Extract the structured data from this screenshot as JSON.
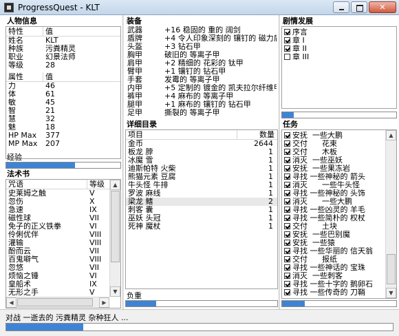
{
  "window": {
    "title": "ProgressQuest - KLT"
  },
  "character": {
    "header": "人物信息",
    "col_trait": "特性",
    "col_value": "值",
    "traits": [
      {
        "name": "姓名",
        "value": "KLT"
      },
      {
        "name": "种族",
        "value": "污粪精灵"
      },
      {
        "name": "职业",
        "value": "幻景法师"
      },
      {
        "name": "等级",
        "value": "28"
      }
    ],
    "col_stat": "属性",
    "col_stat_value": "值",
    "stats": [
      {
        "name": "力",
        "value": "46"
      },
      {
        "name": "体",
        "value": "61"
      },
      {
        "name": "敏",
        "value": "45"
      },
      {
        "name": "智",
        "value": "21"
      },
      {
        "name": "慧",
        "value": "32"
      },
      {
        "name": "魅",
        "value": "18"
      },
      {
        "name": "HP Max",
        "value": "377"
      },
      {
        "name": "MP Max",
        "value": "207"
      }
    ],
    "exp_label": "经验",
    "exp_progress": 0.6
  },
  "spellbook": {
    "header": "法术书",
    "col_spell": "咒语",
    "col_level": "等级",
    "spells": [
      {
        "name": "史莱姆之触",
        "level": "V"
      },
      {
        "name": "忽伤",
        "level": "X"
      },
      {
        "name": "急速",
        "level": "IX"
      },
      {
        "name": "磁性球",
        "level": "VII"
      },
      {
        "name": "免子的正义铁拳",
        "level": "VI"
      },
      {
        "name": "伶俐优伴",
        "level": "VIII"
      },
      {
        "name": "灌输",
        "level": "VIII"
      },
      {
        "name": "酚而云",
        "level": "VII"
      },
      {
        "name": "百鬼噼气",
        "level": "VIII"
      },
      {
        "name": "忽悠",
        "level": "VII"
      },
      {
        "name": "烦恼之锤",
        "level": "VI"
      },
      {
        "name": "皇船术",
        "level": "IX"
      },
      {
        "name": "无形之手",
        "level": "V"
      }
    ]
  },
  "equipment": {
    "header": "装备",
    "items": [
      {
        "slot": "武器",
        "item": "+16 稳固的 重的 阔剑"
      },
      {
        "slot": "盾牌",
        "item": "+4 令人印象深刻的 镶钉的 磁力盾"
      },
      {
        "slot": "头盔",
        "item": "+3 钻石甲"
      },
      {
        "slot": "胸甲",
        "item": "破旧的 等离子甲"
      },
      {
        "slot": "肩甲",
        "item": "+2 精细的 花彩的 钛甲"
      },
      {
        "slot": "臂甲",
        "item": "+1 镶钉的 钻石甲"
      },
      {
        "slot": "手套",
        "item": "发霉的 等离子甲"
      },
      {
        "slot": "内甲",
        "item": "+5 定制的 镀金的 凯夫拉尔纤维甲"
      },
      {
        "slot": "裤甲",
        "item": "+4 麻布的 等离子甲"
      },
      {
        "slot": "腿甲",
        "item": "+1 麻布的 镶钉的 钻石甲"
      },
      {
        "slot": "足甲",
        "item": "撕裂的 等离子甲"
      }
    ]
  },
  "inventory": {
    "header": "详细目录",
    "col_item": "项目",
    "col_qty": "数量",
    "items": [
      {
        "name": "金币",
        "qty": "2644"
      },
      {
        "name": "板龙 脖",
        "qty": "1"
      },
      {
        "name": "冰魔 雪",
        "qty": "1"
      },
      {
        "name": "迪斯帕特 火柴",
        "qty": "1"
      },
      {
        "name": "熊猫元素 豆腐",
        "qty": "1"
      },
      {
        "name": "牛头怪 牛排",
        "qty": "1"
      },
      {
        "name": "罗波 麻线",
        "qty": "1"
      },
      {
        "name": "梁龙 鳍",
        "qty": "2"
      },
      {
        "name": "刺客 囊",
        "qty": "1"
      },
      {
        "name": "巫妖 头冠",
        "qty": "1"
      },
      {
        "name": "死神 魔杖",
        "qty": "1"
      }
    ],
    "burden_label": "负重",
    "burden_progress": 0.2
  },
  "plot": {
    "header": "剧情发展",
    "acts": [
      {
        "label": "序言",
        "done": true
      },
      {
        "label": "章 I",
        "done": true
      },
      {
        "label": "章 II",
        "done": true
      },
      {
        "label": "章 III",
        "done": false
      }
    ],
    "progress": 0.1
  },
  "quests": {
    "header": "任务",
    "items": [
      {
        "text": "安抚  一些大鹏",
        "done": true
      },
      {
        "text": "交付      花束",
        "done": true
      },
      {
        "text": "交付      木板",
        "done": true
      },
      {
        "text": "消灭  一些巫妖",
        "done": true
      },
      {
        "text": "安抚  一些果冻岩",
        "done": true
      },
      {
        "text": "寻找 一些神秘的 箭头",
        "done": true
      },
      {
        "text": "消灭      一些牛头怪",
        "done": true
      },
      {
        "text": "寻找 一些神秘的 头饰",
        "done": true
      },
      {
        "text": "消灭      一些大鹏",
        "done": true
      },
      {
        "text": "寻找 一些凶灵的 羊毛",
        "done": true
      },
      {
        "text": "寻找 一些简朴的 权杖",
        "done": true
      },
      {
        "text": "交付      土块",
        "done": true
      },
      {
        "text": "安抚  一些巴别魔",
        "done": true
      },
      {
        "text": "安抚  一些猿",
        "done": true
      },
      {
        "text": "寻找 一些华丽的 信天翁",
        "done": true
      },
      {
        "text": "交付      报纸",
        "done": true
      },
      {
        "text": "寻找 一些神话的 宝珠",
        "done": true
      },
      {
        "text": "消灭  一些刺客",
        "done": true
      },
      {
        "text": "寻找 一些十字的 鹅卵石",
        "done": true
      },
      {
        "text": "寻找 一些传奇的 刀鞘",
        "done": true
      }
    ],
    "progress": 0.2
  },
  "status": {
    "text": "对战  一逝去的  污粪精灵  杂种狂人 ...",
    "progress": 0.2
  }
}
